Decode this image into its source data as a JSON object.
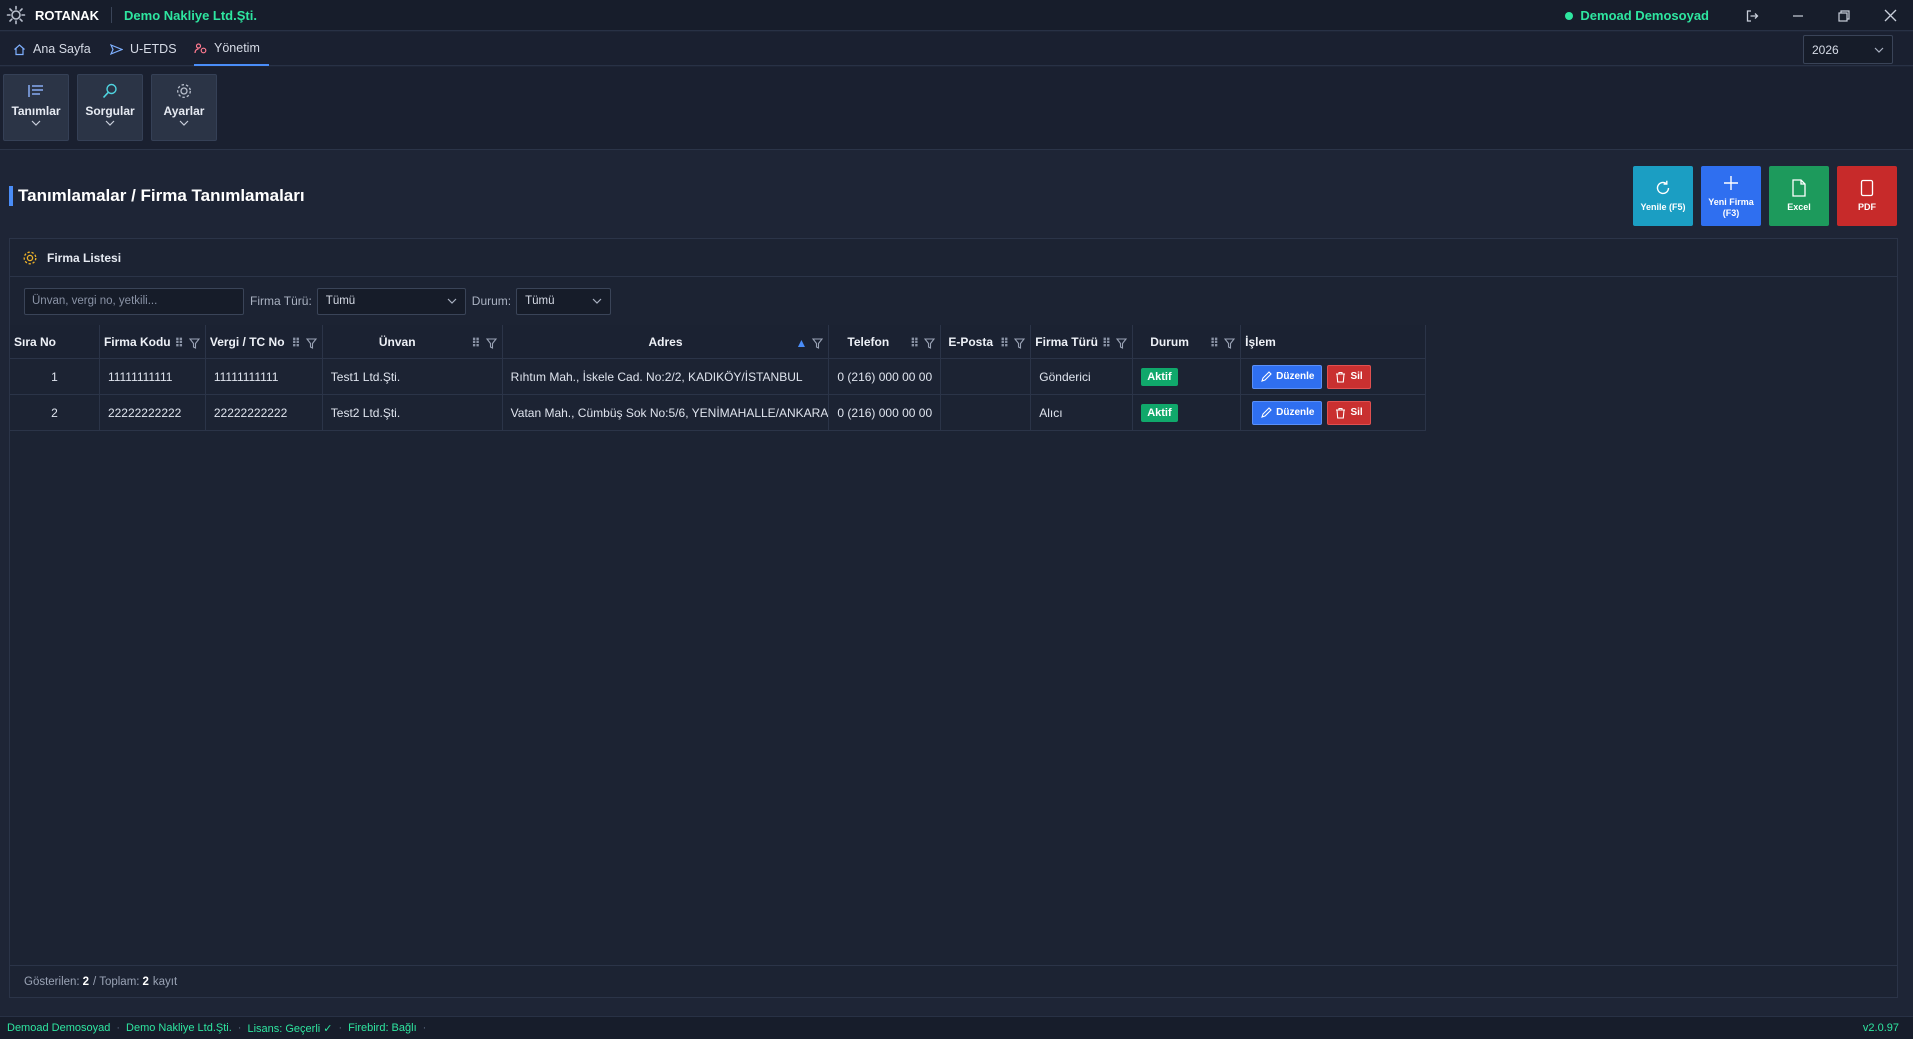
{
  "titlebar": {
    "app_name": "ROTANAK",
    "company": "Demo Nakliye Ltd.Şti.",
    "user": "Demoad Demosoyad"
  },
  "tabs": [
    {
      "label": "Ana Sayfa",
      "icon": "home-icon"
    },
    {
      "label": "U-ETDS",
      "icon": "send-icon"
    },
    {
      "label": "Yönetim",
      "icon": "admin-icon",
      "active": true
    }
  ],
  "year_select": {
    "value": "2026"
  },
  "ribbon": [
    {
      "label": "Tanımlar",
      "icon": "list-icon"
    },
    {
      "label": "Sorgular",
      "icon": "search-icon"
    },
    {
      "label": "Ayarlar",
      "icon": "gear-icon"
    }
  ],
  "page": {
    "title": "Tanımlamalar / Firma Tanımlamaları"
  },
  "actions": [
    {
      "label": "Yenile (F5)",
      "icon": "refresh-icon",
      "color": "#1b9ec3"
    },
    {
      "label": "Yeni Firma (F3)",
      "icon": "plus-icon",
      "color": "#2f6ff0"
    },
    {
      "label": "Excel",
      "icon": "file-icon",
      "color": "#1d9a5c"
    },
    {
      "label": "PDF",
      "icon": "document-icon",
      "color": "#c72a2a"
    }
  ],
  "panel": {
    "title": "Firma Listesi"
  },
  "filters": {
    "search_placeholder": "Ünvan, vergi no, yetkili...",
    "firm_type_label": "Firma Türü:",
    "firm_type_value": "Tümü",
    "status_label": "Durum:",
    "status_value": "Tümü"
  },
  "table": {
    "columns": [
      "Sıra No",
      "Firma Kodu",
      "Vergi / TC No",
      "Ünvan",
      "Adres",
      "Telefon",
      "E-Posta",
      "Firma Türü",
      "Durum",
      "İşlem"
    ],
    "sort_column": "Adres",
    "sort_direction": "asc",
    "rows": [
      {
        "no": "1",
        "code": "11111111111",
        "tax": "11111111111",
        "title": "Test1 Ltd.Şti.",
        "address": "Rıhtım Mah., İskele Cad. No:2/2, KADIKÖY/İSTANBUL",
        "phone": "0 (216) 000 00 00",
        "email": "",
        "type": "Gönderici",
        "status": "Aktif"
      },
      {
        "no": "2",
        "code": "22222222222",
        "tax": "22222222222",
        "title": "Test2 Ltd.Şti.",
        "address": "Vatan Mah., Cümbüş Sok No:5/6, YENİMAHALLE/ANKARA",
        "phone": "0 (216) 000 00 00",
        "email": "",
        "type": "Alıcı",
        "status": "Aktif"
      }
    ],
    "edit_label": "Düzenle",
    "delete_label": "Sil"
  },
  "footer": {
    "shown_label": "Gösterilen:",
    "shown_count": "2",
    "total_label": "/ Toplam:",
    "total_count": "2",
    "unit": "kayıt"
  },
  "statusbar": {
    "user": "Demoad Demosoyad",
    "company": "Demo Nakliye Ltd.Şti.",
    "license": "Lisans: Geçerli ✓",
    "db": "Firebird: Bağlı",
    "version": "v2.0.97"
  },
  "colors": {
    "accent": "#4a8df8",
    "success": "#2ee6a0",
    "active_badge": "#10a86b"
  }
}
